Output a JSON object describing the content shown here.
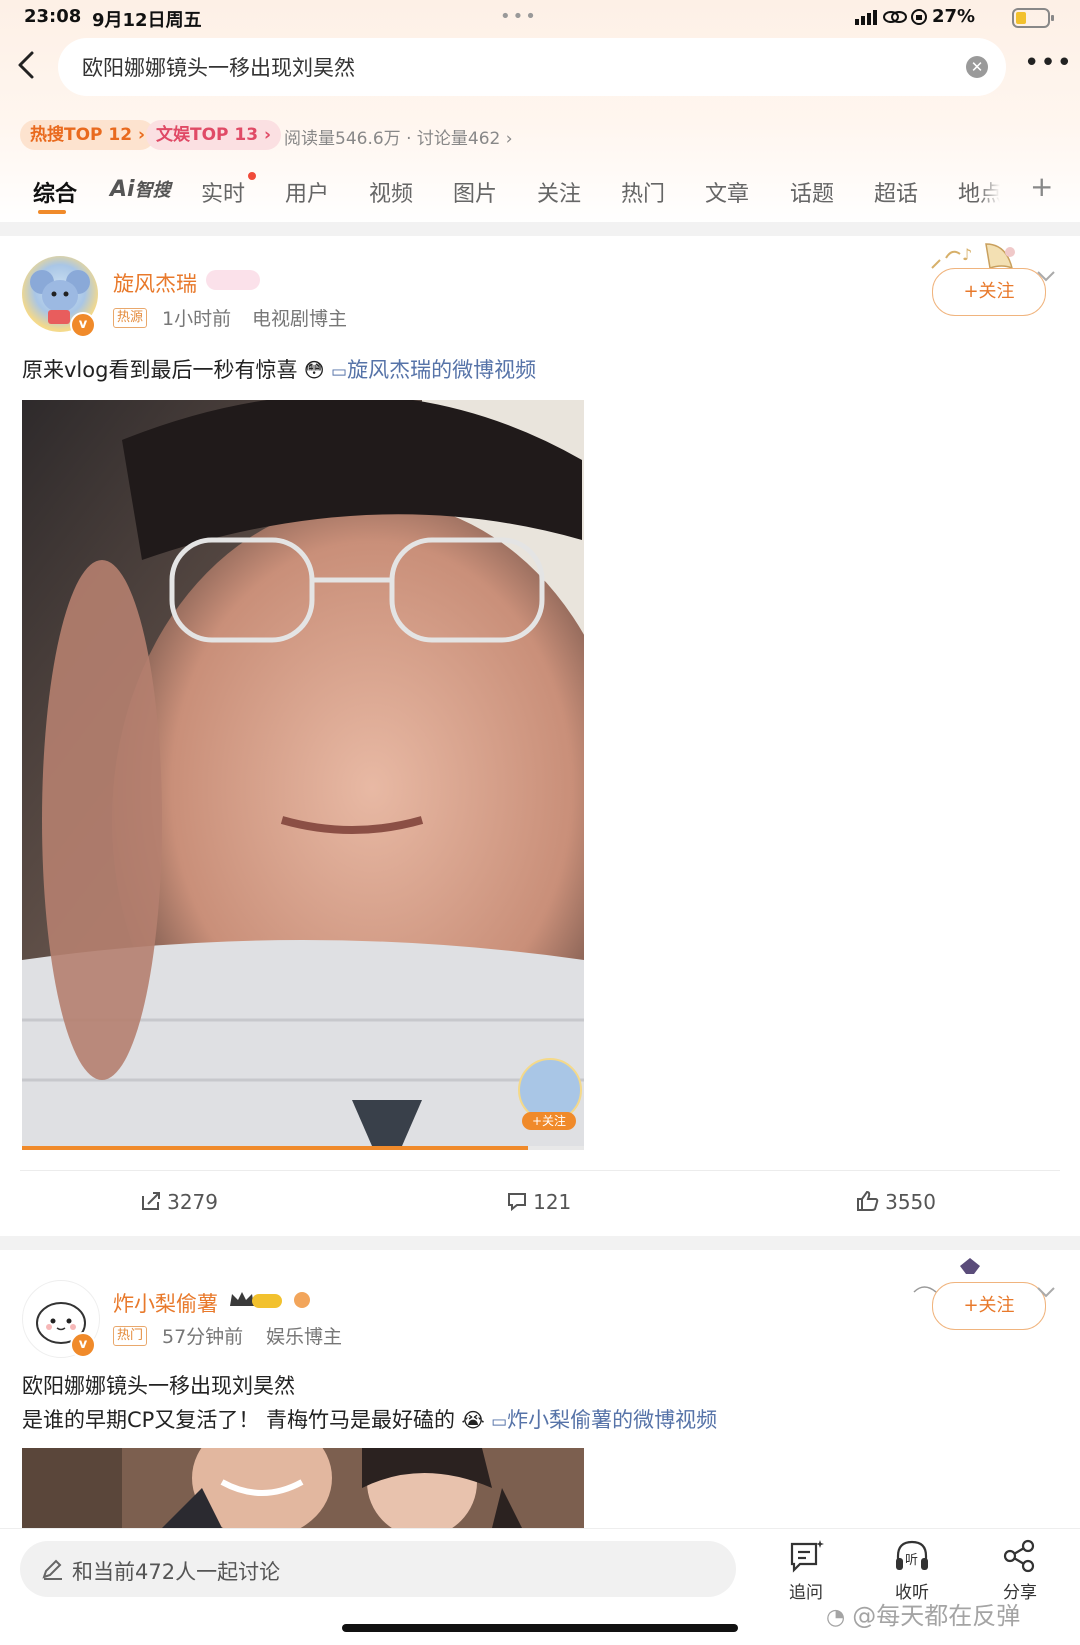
{
  "status_bar": {
    "time": "23:08",
    "date": "9月12日周五",
    "battery": "27%"
  },
  "search": {
    "query": "欧阳娜娜镜头一移出现刘昊然"
  },
  "hot_labels": {
    "hot": "热搜TOP 12",
    "ent": "文娱TOP 13",
    "stats": "阅读量546.6万 · 讨论量462"
  },
  "tabs": [
    "综合",
    "智搜",
    "实时",
    "用户",
    "视频",
    "图片",
    "关注",
    "热门",
    "文章",
    "话题",
    "超话",
    "地点"
  ],
  "ai_prefix": "Ai",
  "posts": [
    {
      "username": "旋风杰瑞",
      "tag": "热源",
      "time": "1小时前",
      "role": "电视剧博主",
      "follow": "+关注",
      "text": "原来vlog看到最后一秒有惊喜",
      "link": "旋风杰瑞的微博视频",
      "float_follow": "+关注",
      "reposts": "3279",
      "comments": "121",
      "likes": "3550",
      "progress": 0.9
    },
    {
      "username": "炸小梨偷薯",
      "tag": "热门",
      "time": "57分钟前",
      "role": "娱乐博主",
      "follow": "+关注",
      "text_line1": "欧阳娜娜镜头一移出现刘昊然",
      "text_line2": "是谁的早期CP又复活了！ 青梅竹马是最好磕的",
      "link": "炸小梨偷薯的微博视频"
    }
  ],
  "bottom": {
    "placeholder": "和当前472人一起讨论",
    "follow_up": "追问",
    "listen": "收听",
    "share": "分享",
    "watermark": "@每天都在反弹"
  }
}
